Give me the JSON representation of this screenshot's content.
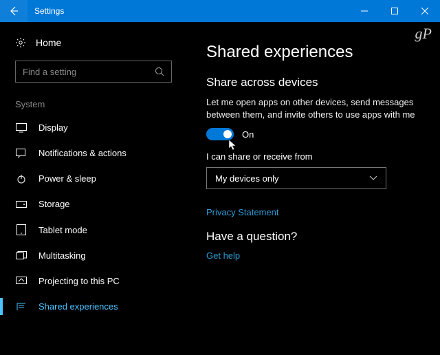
{
  "titlebar": {
    "title": "Settings"
  },
  "sidebar": {
    "home": "Home",
    "search_placeholder": "Find a setting",
    "group": "System",
    "items": [
      {
        "label": "Display"
      },
      {
        "label": "Notifications & actions"
      },
      {
        "label": "Power & sleep"
      },
      {
        "label": "Storage"
      },
      {
        "label": "Tablet mode"
      },
      {
        "label": "Multitasking"
      },
      {
        "label": "Projecting to this PC"
      },
      {
        "label": "Shared experiences"
      }
    ]
  },
  "content": {
    "title": "Shared experiences",
    "section1_title": "Share across devices",
    "section1_desc": "Let me open apps on other devices, send messages between them, and invite others to use apps with me",
    "toggle_state": "On",
    "share_from_label": "I can share or receive from",
    "dropdown_value": "My devices only",
    "privacy_link": "Privacy Statement",
    "question_title": "Have a question?",
    "help_link": "Get help"
  },
  "watermark": "gP"
}
